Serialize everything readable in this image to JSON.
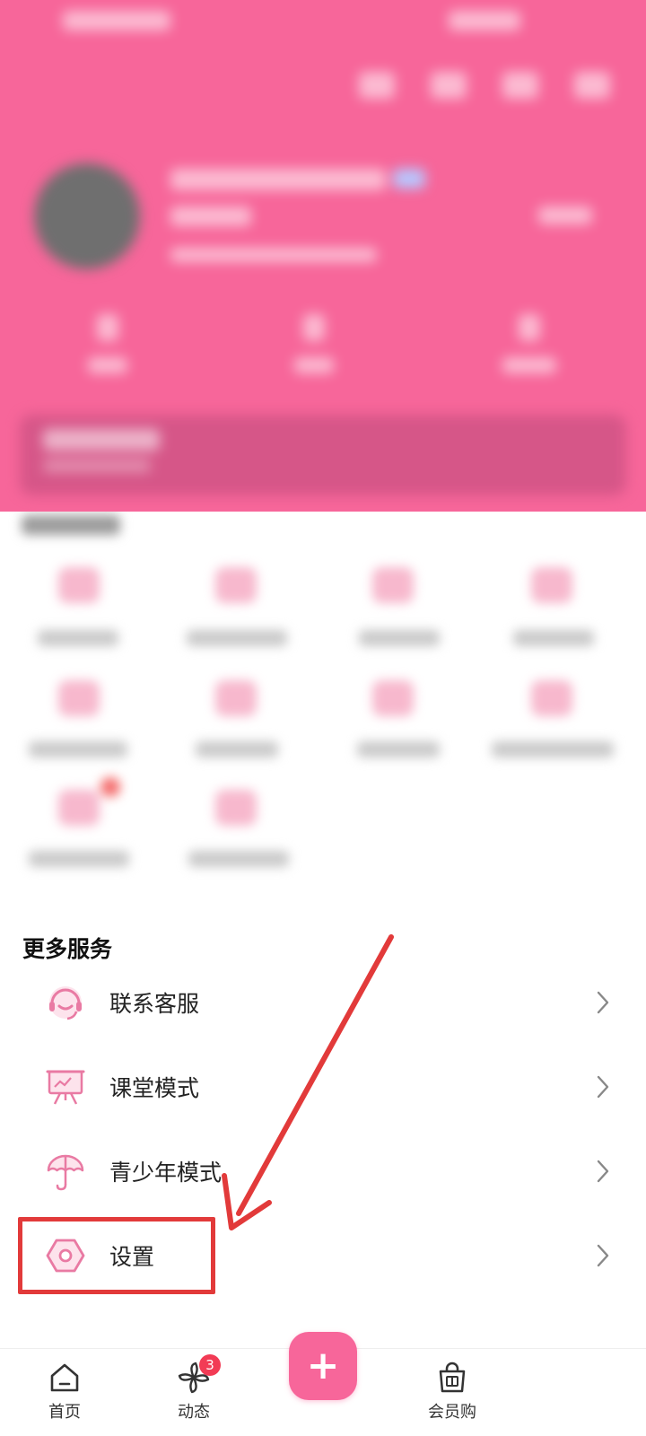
{
  "colors": {
    "brand_pink": "#f7669a",
    "icon_pink": "#e97aa3",
    "annotation_red": "#e23a3a",
    "badge_red": "#f23b55"
  },
  "more_services": {
    "title": "更多服务",
    "items": [
      {
        "label": "联系客服",
        "icon": "headset-icon"
      },
      {
        "label": "课堂模式",
        "icon": "presentation-board-icon"
      },
      {
        "label": "青少年模式",
        "icon": "umbrella-icon"
      },
      {
        "label": "设置",
        "icon": "settings-hexagon-icon"
      }
    ]
  },
  "bottom_nav": {
    "home_label": "首页",
    "dynamics_label": "动态",
    "dynamics_badge": "3",
    "publish_symbol": "+",
    "vip_shop_label": "会员购"
  }
}
